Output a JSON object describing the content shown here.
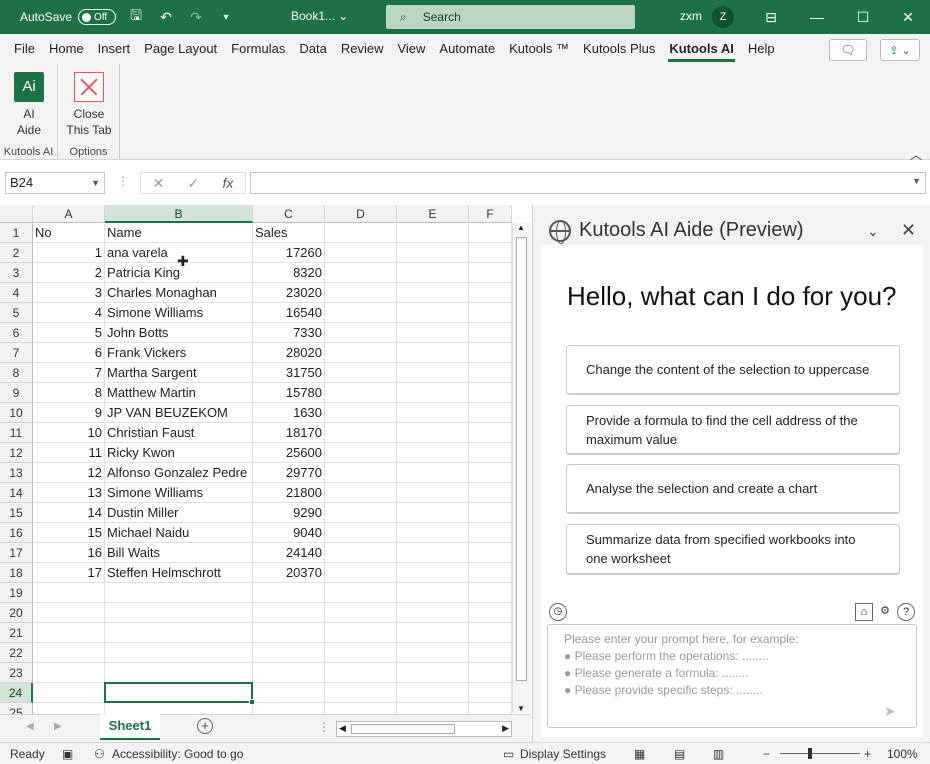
{
  "titlebar": {
    "autosave_label": "AutoSave",
    "autosave_state": "Off",
    "file_name": "Book1...",
    "search_placeholder": "Search",
    "user_name": "zxm",
    "user_initial": "Z"
  },
  "menu": {
    "tabs": [
      "File",
      "Home",
      "Insert",
      "Page Layout",
      "Formulas",
      "Data",
      "Review",
      "View",
      "Automate",
      "Kutools ™",
      "Kutools Plus",
      "Kutools AI",
      "Help"
    ],
    "active": "Kutools AI"
  },
  "ribbon": {
    "ai_aide_label": "AI\nAide",
    "ai_icon_text": "Ai",
    "ai_aide_line1": "AI",
    "ai_aide_line2": "Aide",
    "group1_label": "Kutools AI",
    "close_line1": "Close",
    "close_line2": "This Tab",
    "group2_label": "Options"
  },
  "formula_bar": {
    "name_box": "B24",
    "fx": "fx",
    "value": ""
  },
  "sheet": {
    "columns": [
      "A",
      "B",
      "C",
      "D",
      "E",
      "F"
    ],
    "selected_column": "B",
    "selected_row": 24,
    "rows": [
      {
        "n": "1",
        "a": "No",
        "b": "Name",
        "c": "Sales"
      },
      {
        "n": "2",
        "a": "1",
        "b": "ana varela",
        "c": "17260"
      },
      {
        "n": "3",
        "a": "2",
        "b": "Patricia King",
        "c": "8320"
      },
      {
        "n": "4",
        "a": "3",
        "b": "Charles Monaghan",
        "c": "23020"
      },
      {
        "n": "5",
        "a": "4",
        "b": "Simone Williams",
        "c": "16540"
      },
      {
        "n": "6",
        "a": "5",
        "b": "John Botts",
        "c": "7330"
      },
      {
        "n": "7",
        "a": "6",
        "b": "Frank Vickers",
        "c": "28020"
      },
      {
        "n": "8",
        "a": "7",
        "b": "Martha Sargent",
        "c": "31750"
      },
      {
        "n": "9",
        "a": "8",
        "b": "Matthew Martin",
        "c": "15780"
      },
      {
        "n": "10",
        "a": "9",
        "b": "JP VAN BEUZEKOM",
        "c": "1630"
      },
      {
        "n": "11",
        "a": "10",
        "b": "Christian Faust",
        "c": "18170"
      },
      {
        "n": "12",
        "a": "11",
        "b": "Ricky Kwon",
        "c": "25600"
      },
      {
        "n": "13",
        "a": "12",
        "b": "Alfonso Gonzalez Pedre",
        "c": "29770"
      },
      {
        "n": "14",
        "a": "13",
        "b": "Simone Williams",
        "c": "21800"
      },
      {
        "n": "15",
        "a": "14",
        "b": "Dustin Miller",
        "c": "9290"
      },
      {
        "n": "16",
        "a": "15",
        "b": "Michael Naidu",
        "c": "9040"
      },
      {
        "n": "17",
        "a": "16",
        "b": "Bill Waits",
        "c": "24140"
      },
      {
        "n": "18",
        "a": "17",
        "b": "Steffen Helmschrott",
        "c": "20370"
      },
      {
        "n": "19",
        "a": "",
        "b": "",
        "c": ""
      },
      {
        "n": "20",
        "a": "",
        "b": "",
        "c": ""
      },
      {
        "n": "21",
        "a": "",
        "b": "",
        "c": ""
      },
      {
        "n": "22",
        "a": "",
        "b": "",
        "c": ""
      },
      {
        "n": "23",
        "a": "",
        "b": "",
        "c": ""
      },
      {
        "n": "24",
        "a": "",
        "b": "",
        "c": ""
      },
      {
        "n": "25",
        "a": "",
        "b": "",
        "c": ""
      }
    ],
    "tab_name": "Sheet1"
  },
  "ai_panel": {
    "title": "Kutools AI Aide (Preview)",
    "greeting": "Hello, what can I do for you?",
    "suggestions": [
      "Change the content of the selection to uppercase",
      "Provide a formula to find the cell address of the maximum value",
      "Analyse the selection and create a chart",
      "Summarize data from specified workbooks into one worksheet"
    ],
    "prompt_line1": "Please enter your prompt here, for example:",
    "prompt_line2": "● Please perform the operations: ........",
    "prompt_line3": "● Please generate a formula: ........",
    "prompt_line4": "● Please provide specific steps: ........"
  },
  "statusbar": {
    "ready": "Ready",
    "accessibility": "Accessibility: Good to go",
    "display_settings": "Display Settings",
    "zoom": "100%",
    "zoom_minus": "−",
    "zoom_plus": "+"
  },
  "colors": {
    "accent": "#1e7145"
  }
}
